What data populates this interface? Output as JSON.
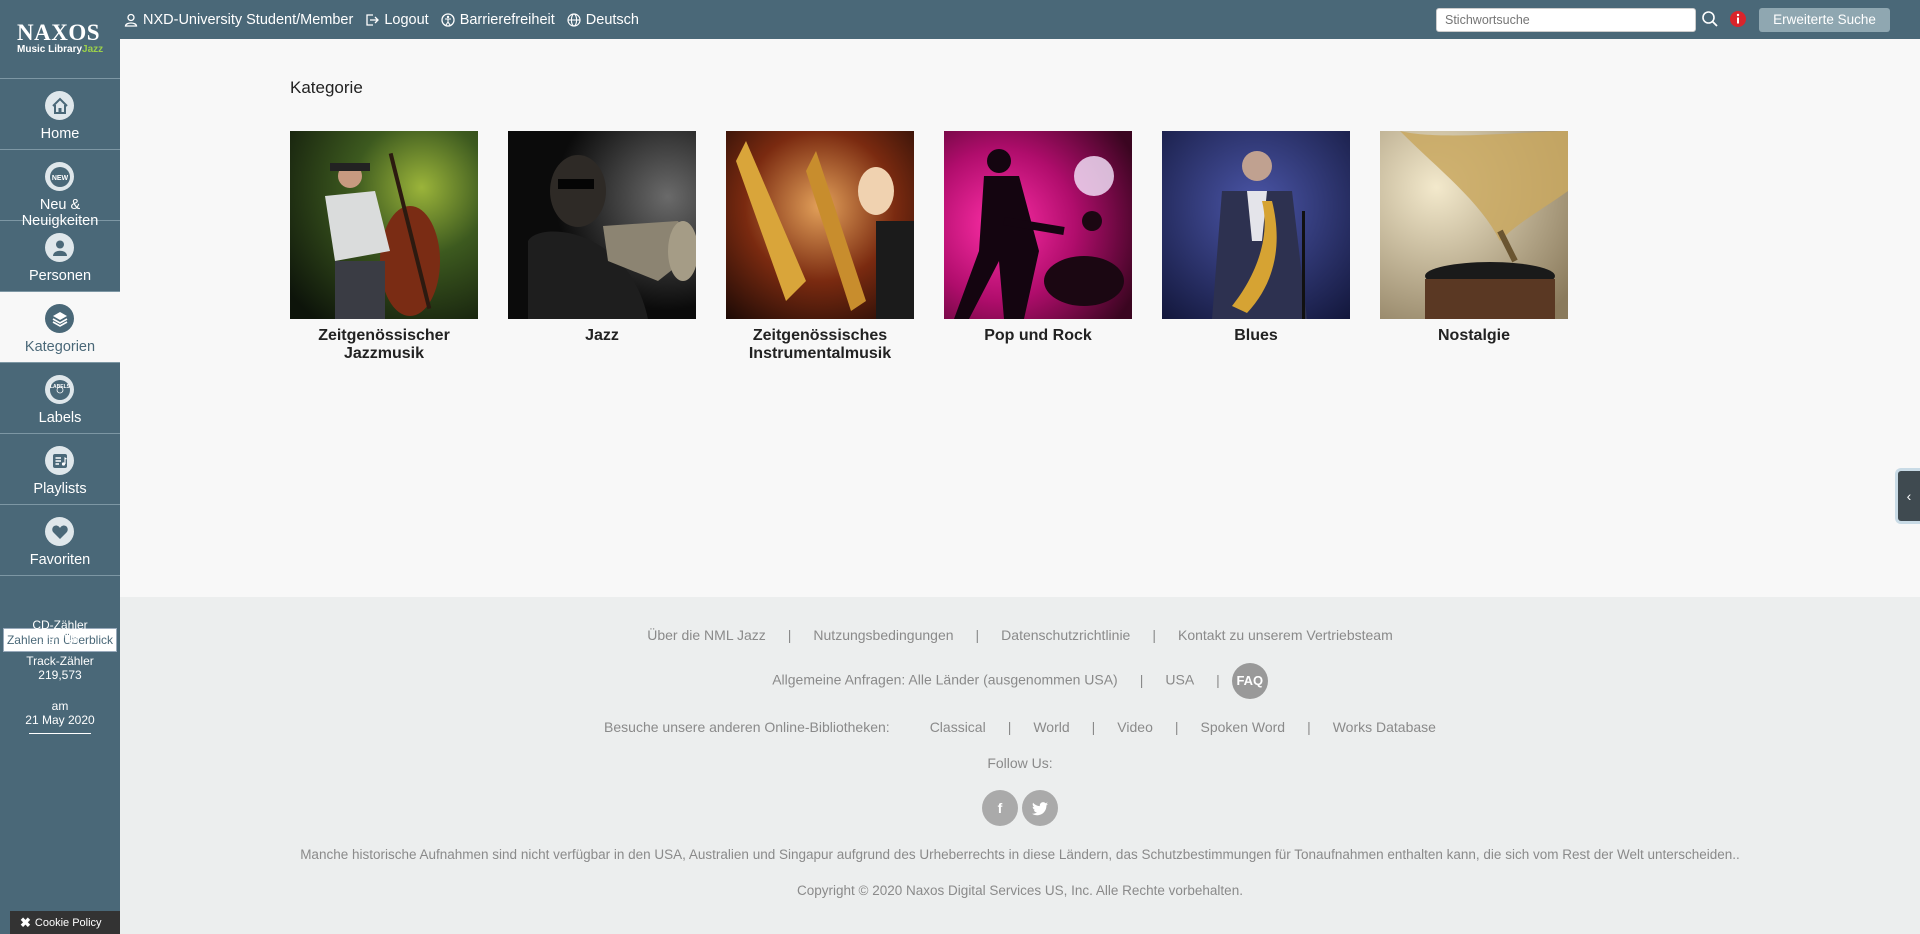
{
  "brand": {
    "logo_main": "NAXOS",
    "logo_sub": "Music Library",
    "logo_jazz": "Jazz"
  },
  "topnav": {
    "user": "NXD-University Student/Member",
    "logout": "Logout",
    "accessibility": "Barrierefreiheit",
    "language": "Deutsch"
  },
  "search": {
    "placeholder": "Stichwortsuche",
    "advanced": "Erweiterte Suche"
  },
  "sidebar": {
    "items": [
      {
        "label": "Home",
        "icon": "home-icon"
      },
      {
        "label": "Neu & Neuigkeiten",
        "icon": "new-icon"
      },
      {
        "label": "Personen",
        "icon": "person-icon"
      },
      {
        "label": "Kategorien",
        "icon": "layers-icon",
        "active": true
      },
      {
        "label": "Labels",
        "icon": "labels-icon"
      },
      {
        "label": "Playlists",
        "icon": "playlist-icon"
      },
      {
        "label": "Favoriten",
        "icon": "heart-icon"
      }
    ],
    "stats_button": "Zahlen im Überblick",
    "cd_label": "CD-Zähler",
    "cd_value": "19,248",
    "track_label": "Track-Zähler",
    "track_value": "219,573",
    "date_label": "am",
    "date_value": "21 May 2020",
    "cookie": "Cookie Policy"
  },
  "main": {
    "title": "Kategorie",
    "categories": [
      {
        "name": "Zeitgenössischer Jazzmusik"
      },
      {
        "name": "Jazz"
      },
      {
        "name": "Zeitgenössisches Instrumentalmusik"
      },
      {
        "name": "Pop und Rock"
      },
      {
        "name": "Blues"
      },
      {
        "name": "Nostalgie"
      }
    ]
  },
  "footer": {
    "row1": [
      "Über die NML Jazz",
      "Nutzungsbedingungen",
      "Datenschutzrichtlinie",
      "Kontakt zu unserem Vertriebsteam"
    ],
    "row2_general": "Allgemeine Anfragen: Alle Länder (ausgenommen USA)",
    "row2_usa": "USA",
    "faq": "FAQ",
    "row3_label": "Besuche unsere anderen Online-Bibliotheken:",
    "row3_links": [
      "Classical",
      "World",
      "Video",
      "Spoken Word",
      "Works Database"
    ],
    "follow": "Follow Us:",
    "facebook": "f",
    "twitter_icon": "twitter-icon",
    "disclaimer": "Manche historische Aufnahmen sind nicht verfügbar in den USA, Australien und Singapur aufgrund des Urheberrechts in diese Ländern, das Schutzbestimmungen für Tonaufnahmen enthalten kann, die sich vom Rest der Welt unterscheiden..",
    "copyright": "Copyright © 2020 Naxos Digital Services US, Inc. Alle Rechte vorbehalten."
  },
  "separator": "|",
  "colors": {
    "brand": "#4a6878",
    "jazz_accent": "#9bd04a",
    "info_red": "#d9242b"
  }
}
